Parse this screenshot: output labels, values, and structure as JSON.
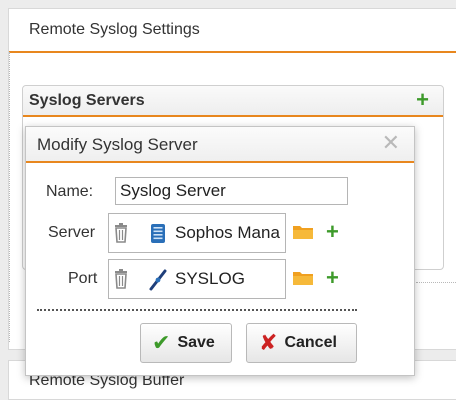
{
  "settings_panel": {
    "title": "Remote Syslog Settings"
  },
  "servers_box": {
    "title": "Syslog Servers",
    "add_icon": "plus-icon"
  },
  "buffer_panel": {
    "title": "Remote Syslog Buffer"
  },
  "modal": {
    "title": "Modify Syslog Server",
    "close_icon": "close-icon",
    "name_label": "Name:",
    "name_value": "Syslog Server",
    "server_label": "Server",
    "server_value": "Sophos Mana",
    "port_label": "Port",
    "port_value": "SYSLOG",
    "save_label": "Save",
    "cancel_label": "Cancel"
  },
  "colors": {
    "accent": "#e8871e",
    "add_green": "#3d9a2a",
    "cancel_red": "#cc2222",
    "folder_orange": "#f0a020",
    "host_blue": "#2a6fb8"
  }
}
